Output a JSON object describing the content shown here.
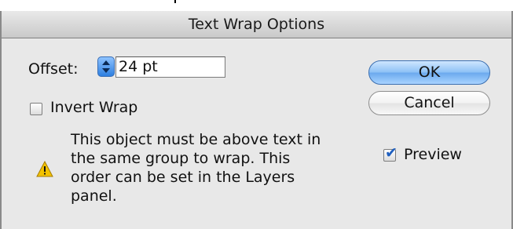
{
  "dialog": {
    "title": "Text Wrap Options"
  },
  "offset": {
    "label": "Offset:",
    "value": "24 pt"
  },
  "invert_wrap": {
    "label": "Invert Wrap",
    "checked": false
  },
  "warning": {
    "icon": "warning-icon",
    "text": "This object must be above text in\nthe same group to wrap. This\norder can be set in the Layers\npanel."
  },
  "buttons": {
    "ok_label": "OK",
    "cancel_label": "Cancel"
  },
  "preview": {
    "label": "Preview",
    "checked": true
  },
  "colors": {
    "accent": "#6aa9ee",
    "warning": "#f2c200"
  }
}
